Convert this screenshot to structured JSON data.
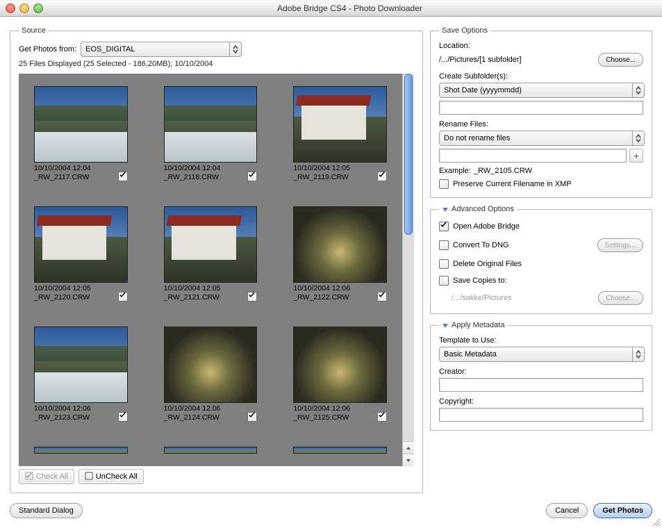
{
  "window_title": "Adobe Bridge CS4 - Photo Downloader",
  "source": {
    "legend": "Source",
    "get_photos_from_label": "Get Photos from:",
    "device": "EOS_DIGITAL",
    "status": "25 Files Displayed (25 Selected - 186,20MB); 10/10/2004",
    "check_all": "Check All",
    "uncheck_all": "UnCheck All"
  },
  "thumbs": [
    {
      "date": "10/10/2004 12:04",
      "file": "_RW_2117.CRW",
      "variant": "snow"
    },
    {
      "date": "10/10/2004 12:04",
      "file": "_RW_2118.CRW",
      "variant": "snow"
    },
    {
      "date": "10/10/2004 12:05",
      "file": "_RW_2119.CRW",
      "variant": "house"
    },
    {
      "date": "10/10/2004 12:05",
      "file": "_RW_2120.CRW",
      "variant": "house"
    },
    {
      "date": "10/10/2004 12:05",
      "file": "_RW_2121.CRW",
      "variant": "house"
    },
    {
      "date": "10/10/2004 12:06",
      "file": "_RW_2122.CRW",
      "variant": "puddle"
    },
    {
      "date": "10/10/2004 12:06",
      "file": "_RW_2123.CRW",
      "variant": "snow"
    },
    {
      "date": "10/10/2004 12:06",
      "file": "_RW_2124.CRW",
      "variant": "puddle"
    },
    {
      "date": "10/10/2004 12:06",
      "file": "_RW_2125.CRW",
      "variant": "puddle"
    }
  ],
  "save": {
    "legend": "Save Options",
    "location_label": "Location:",
    "location_path": "/.../Pictures/[1 subfolder]",
    "choose": "Choose...",
    "create_subfolder_label": "Create Subfolder(s):",
    "create_subfolder_value": "Shot Date (yyyymmdd)",
    "rename_label": "Rename Files:",
    "rename_value": "Do not rename files",
    "plus": "+",
    "example_label": "Example:",
    "example_value": "_RW_2105.CRW",
    "preserve_label": "Preserve Current Filename in XMP"
  },
  "advanced": {
    "legend": "Advanced Options",
    "open_bridge": "Open Adobe Bridge",
    "convert_dng": "Convert To DNG",
    "settings": "Settings...",
    "delete_originals": "Delete Original Files",
    "save_copies": "Save Copies to:",
    "copies_path": "/.../sakke/Pictures",
    "choose": "Choose..."
  },
  "metadata": {
    "legend": "Apply Metadata",
    "template_label": "Template to Use:",
    "template_value": "Basic Metadata",
    "creator_label": "Creator:",
    "copyright_label": "Copyright:"
  },
  "footer": {
    "standard_dialog": "Standard Dialog",
    "cancel": "Cancel",
    "get_photos": "Get Photos"
  }
}
